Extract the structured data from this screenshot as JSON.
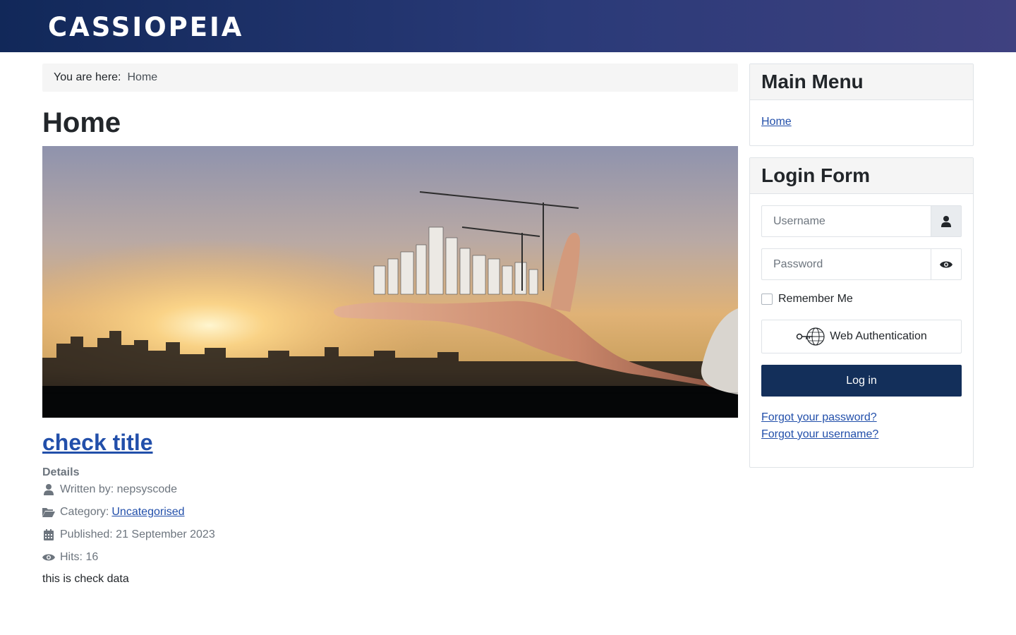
{
  "header": {
    "brand": "CASSIOPEIA"
  },
  "breadcrumb": {
    "prefix": "You are here:",
    "current": "Home"
  },
  "page": {
    "title": "Home"
  },
  "article": {
    "title": "check title",
    "details_label": "Details",
    "author_label": "Written by: nepsyscode",
    "category_prefix": "Category:",
    "category": "Uncategorised",
    "published": "Published: 21 September 2023",
    "hits": "Hits: 16",
    "body": "this is check data"
  },
  "main_menu": {
    "title": "Main Menu",
    "items": [
      {
        "label": "Home"
      }
    ]
  },
  "login": {
    "title": "Login Form",
    "username_placeholder": "Username",
    "password_placeholder": "Password",
    "remember_label": "Remember Me",
    "webauthn_label": "Web Authentication",
    "login_label": "Log in",
    "forgot_password": "Forgot your password?",
    "forgot_username": "Forgot your username?"
  },
  "icons": {
    "user": "user-icon",
    "folder": "folder-open-icon",
    "calendar": "calendar-icon",
    "eye": "eye-icon",
    "webauthn": "key-globe-icon"
  },
  "colors": {
    "header_start": "#112859",
    "header_end": "#3f4180",
    "link": "#224faa",
    "primary_button": "#132f5a"
  }
}
